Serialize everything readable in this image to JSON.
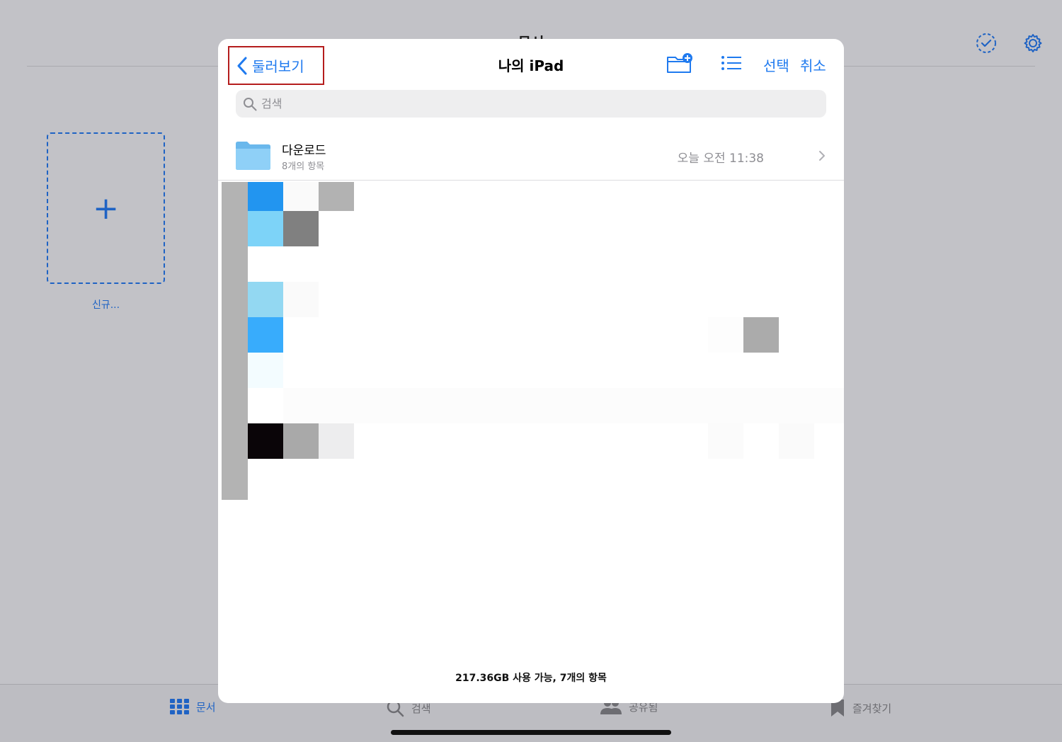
{
  "background": {
    "header_title": "문서",
    "new_document_label": "신규...",
    "tabs": [
      {
        "label": "문서",
        "icon": "grid-icon"
      },
      {
        "label": "검색",
        "icon": "search-icon"
      },
      {
        "label": "공유됨",
        "icon": "people-icon"
      },
      {
        "label": "즐겨찾기",
        "icon": "bookmark-icon"
      }
    ]
  },
  "modal": {
    "back_label": "둘러보기",
    "title": "나의 iPad",
    "select_label": "선택",
    "cancel_label": "취소",
    "search_placeholder": "검색",
    "folder": {
      "name": "다운로드",
      "item_count": "8개의 항목",
      "modified": "오늘 오전 11:38"
    },
    "footer": "217.36GB 사용 가능, 7개의 항목"
  },
  "colors": {
    "accent": "#1f7aef",
    "highlight_border": "#b51d1d",
    "folder": "#7cc7f5"
  }
}
